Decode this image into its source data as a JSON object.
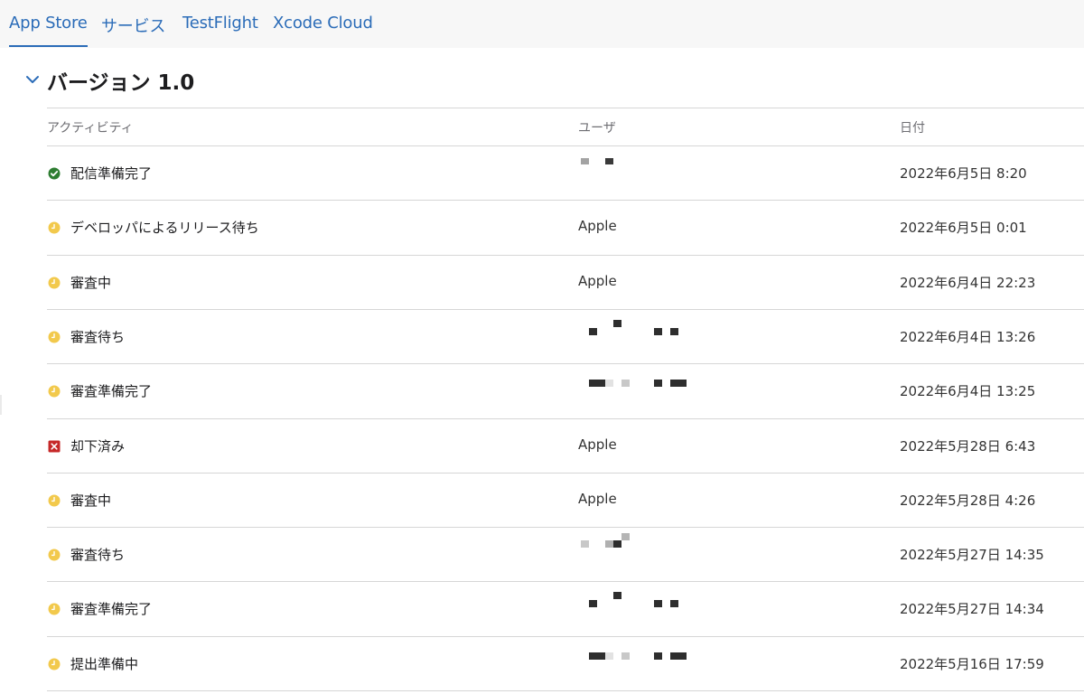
{
  "tabs": [
    {
      "label": "App Store",
      "active": true
    },
    {
      "label": "サービス",
      "active": false
    },
    {
      "label": "TestFlight",
      "active": false
    },
    {
      "label": "Xcode Cloud",
      "active": false
    }
  ],
  "version": {
    "title": "バージョン 1.0",
    "expanded": true
  },
  "table": {
    "headers": {
      "activity": "アクティビティ",
      "user": "ユーザ",
      "date": "日付"
    },
    "rows": [
      {
        "status": "success",
        "icon": "checkmark-circle-icon",
        "activity": "配信準備完了",
        "user": "",
        "user_redacted": true,
        "date": "2022年6月5日 8:20"
      },
      {
        "status": "pending",
        "icon": "clock-icon",
        "activity": "デベロッパによるリリース待ち",
        "user": "Apple",
        "user_redacted": false,
        "date": "2022年6月5日 0:01"
      },
      {
        "status": "pending",
        "icon": "clock-icon",
        "activity": "審査中",
        "user": "Apple",
        "user_redacted": false,
        "date": "2022年6月4日 22:23"
      },
      {
        "status": "pending",
        "icon": "clock-icon",
        "activity": "審査待ち",
        "user": "",
        "user_redacted": true,
        "date": "2022年6月4日 13:26"
      },
      {
        "status": "pending",
        "icon": "clock-icon",
        "activity": "審査準備完了",
        "user": "",
        "user_redacted": true,
        "date": "2022年6月4日 13:25"
      },
      {
        "status": "rejected",
        "icon": "close-square-icon",
        "activity": "却下済み",
        "user": "Apple",
        "user_redacted": false,
        "date": "2022年5月28日 6:43"
      },
      {
        "status": "pending",
        "icon": "clock-icon",
        "activity": "審査中",
        "user": "Apple",
        "user_redacted": false,
        "date": "2022年5月28日 4:26"
      },
      {
        "status": "pending",
        "icon": "clock-icon",
        "activity": "審査待ち",
        "user": "",
        "user_redacted": true,
        "date": "2022年5月27日 14:35"
      },
      {
        "status": "pending",
        "icon": "clock-icon",
        "activity": "審査準備完了",
        "user": "",
        "user_redacted": true,
        "date": "2022年5月27日 14:34"
      },
      {
        "status": "pending",
        "icon": "clock-icon",
        "activity": "提出準備中",
        "user": "",
        "user_redacted": true,
        "date": "2022年5月16日 17:59"
      }
    ]
  },
  "colors": {
    "accent": "#2b6cb8",
    "success": "#2e7d32",
    "pending": "#f2c94c",
    "rejected": "#c62828",
    "divider": "#d6d6d6"
  }
}
